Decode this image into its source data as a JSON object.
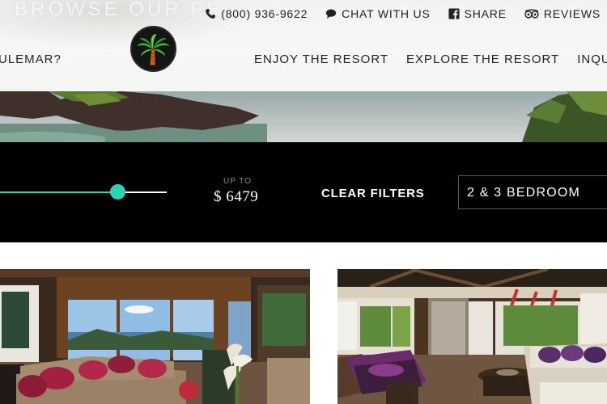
{
  "header": {
    "browse_text": "BROWSE OUR PROP",
    "topbar": {
      "phone": "(800) 936-9622",
      "chat": "CHAT WITH US",
      "share": "SHARE",
      "reviews": "REVIEWS"
    },
    "nav_left": "ULEMAR?",
    "nav": {
      "enjoy": "ENJOY THE RESORT",
      "explore": "EXPLORE THE RESORT",
      "inquire": "INQUIRE &"
    }
  },
  "filters": {
    "price_prefix": "UP TO",
    "price_value": "$ 6479",
    "price_slider_fraction": 0.71,
    "clear_label": "CLEAR FILTERS",
    "bedroom_selected": "2 & 3 BEDROOM"
  },
  "colors": {
    "accent": "#2ed3b6",
    "filter_bg": "#000000",
    "header_bg": "#f5f5f4",
    "text_dark": "#222222"
  },
  "icons": {
    "phone": "phone-icon",
    "chat": "chat-bubble-icon",
    "share": "facebook-icon",
    "reviews": "tripadvisor-owl-icon",
    "logo": "palm-tree-logo"
  }
}
